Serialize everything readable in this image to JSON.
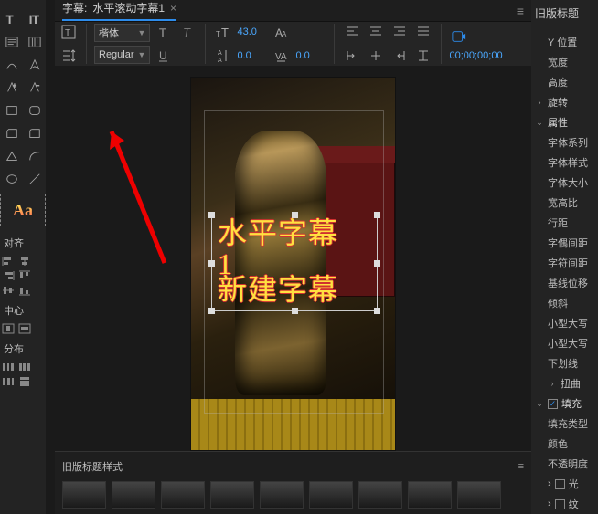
{
  "tab": {
    "prefix": "字幕:",
    "name": "水平滚动字幕1",
    "close": "×",
    "menu": "≡"
  },
  "font": {
    "family": "楷体",
    "weight": "Regular",
    "size": "43.0",
    "leading": "0.0",
    "kerning": "0.0",
    "timecode": "00;00;00;00"
  },
  "caption": {
    "line1": "水平字幕",
    "line2": "1",
    "line3": "新建字幕"
  },
  "left": {
    "align": "对齐",
    "center_label": "中心",
    "distribute": "分布"
  },
  "bottom": {
    "styles_label": "旧版标题样式"
  },
  "right": {
    "panel_title": "旧版标题",
    "ypos": "Y 位置",
    "width": "宽度",
    "height": "高度",
    "rotate": "旋转",
    "attrs": "属性",
    "font_family": "字体系列",
    "font_style": "字体样式",
    "font_size": "字体大小",
    "aspect": "宽高比",
    "leading": "行距",
    "pair_kern": "字偶间距",
    "tracking": "字符间距",
    "baseline": "基线位移",
    "slant": "倾斜",
    "small_caps1": "小型大写",
    "small_caps2": "小型大写",
    "underline": "下划线",
    "distort": "扭曲",
    "fill": "填充",
    "fill_type": "填充类型",
    "color": "颜色",
    "opacity": "不透明度",
    "sheen": "光",
    "texture": "纹"
  }
}
